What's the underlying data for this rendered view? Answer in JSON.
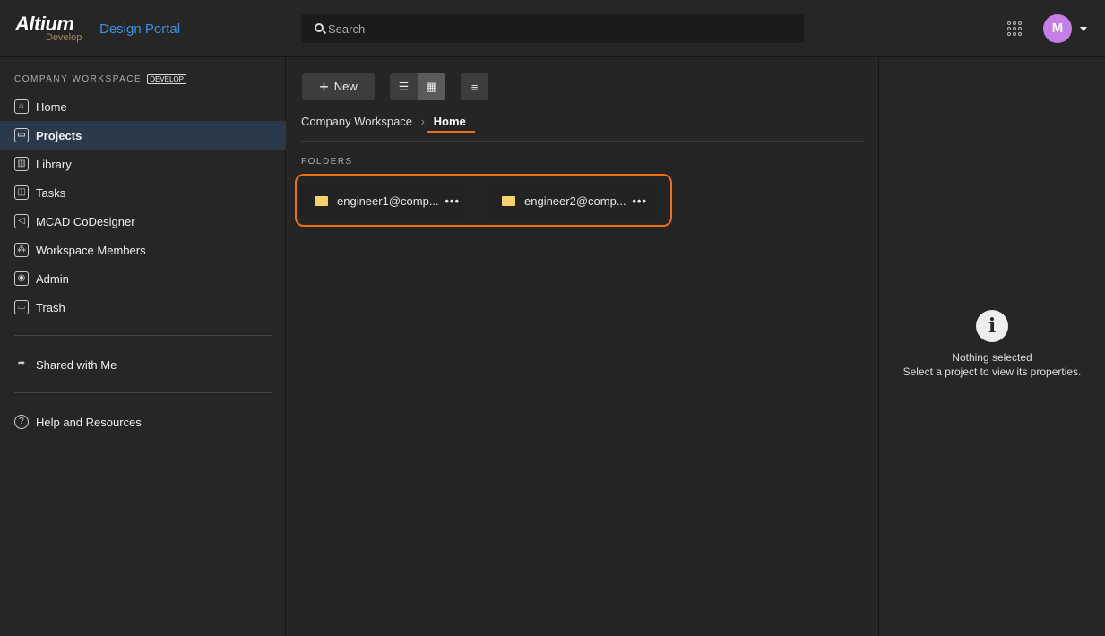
{
  "header": {
    "logo": "Altium",
    "logo_sub": "Develop",
    "portal": "Design Portal",
    "search_placeholder": "Search",
    "avatar": "M"
  },
  "sidebar": {
    "workspace": "COMPANY WORKSPACE",
    "badge": "DEVELOP",
    "items": [
      {
        "label": "Home",
        "icon": "⌂"
      },
      {
        "label": "Projects",
        "icon": "▭"
      },
      {
        "label": "Library",
        "icon": "▥"
      },
      {
        "label": "Tasks",
        "icon": "◫"
      },
      {
        "label": "MCAD CoDesigner",
        "icon": "◁"
      },
      {
        "label": "Workspace Members",
        "icon": "⁂"
      },
      {
        "label": "Admin",
        "icon": "◉"
      },
      {
        "label": "Trash",
        "icon": "⌴"
      }
    ],
    "shared": "Shared with Me",
    "help": "Help and Resources"
  },
  "toolbar": {
    "new_label": "New"
  },
  "breadcrumb": {
    "root": "Company Workspace",
    "current": "Home"
  },
  "folders": {
    "title": "FOLDERS",
    "items": [
      "engineer1@comp...",
      "engineer2@comp..."
    ]
  },
  "details": {
    "title": "Nothing selected",
    "hint": "Select a project to view its properties."
  },
  "colors": {
    "accent": "#f07010",
    "link": "#3f8fe0",
    "active": "#2a3a4b"
  }
}
